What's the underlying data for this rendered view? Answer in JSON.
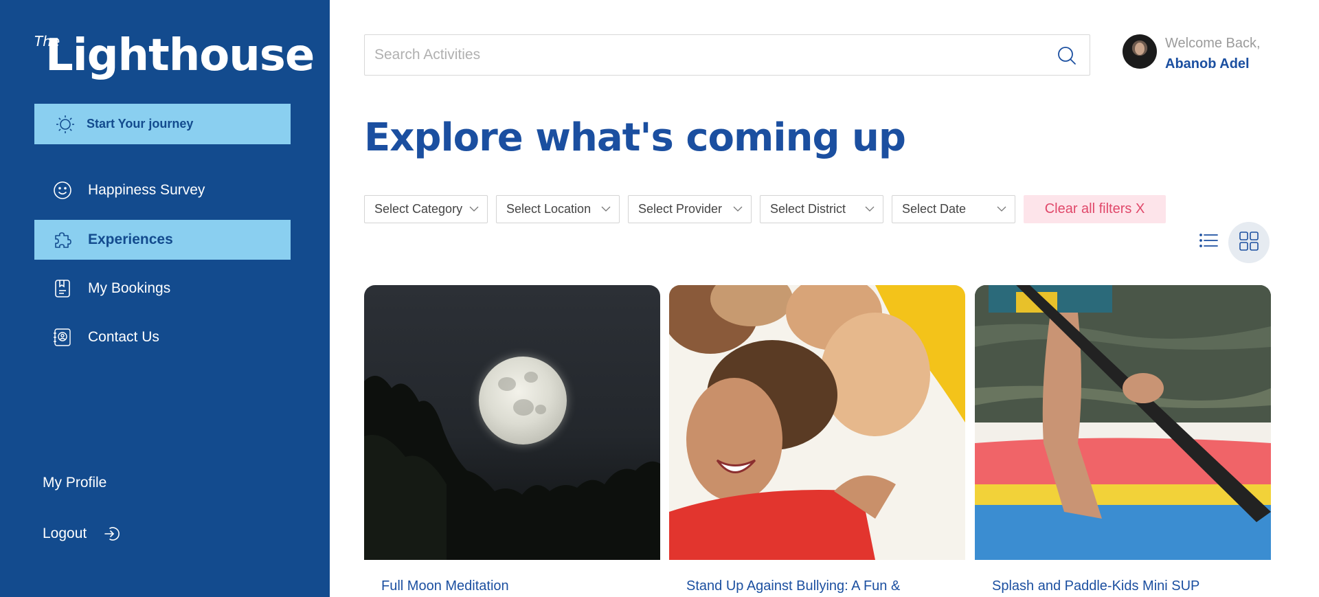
{
  "brand": {
    "logo_the": "The",
    "logo_word": "Lighthouse"
  },
  "sidebar": {
    "journey_label": "Start Your journey",
    "items": [
      {
        "label": "Happiness Survey",
        "icon": "smile-icon",
        "active": false
      },
      {
        "label": "Experiences",
        "icon": "puzzle-icon",
        "active": true
      },
      {
        "label": "My Bookings",
        "icon": "bookings-icon",
        "active": false
      },
      {
        "label": "Contact Us",
        "icon": "contact-icon",
        "active": false
      }
    ],
    "profile_label": "My Profile",
    "logout_label": "Logout"
  },
  "search": {
    "placeholder": "Search Activities"
  },
  "user": {
    "welcome": "Welcome Back,",
    "name": "Abanob Adel"
  },
  "main": {
    "title": "Explore what's coming up",
    "filters": [
      "Select Category",
      "Select Location",
      "Select Provider",
      "Select District",
      "Select Date"
    ],
    "clear_label": "Clear all filters X",
    "view_mode": "grid"
  },
  "cards": [
    {
      "title": "Full Moon Meditation"
    },
    {
      "title": "Stand Up Against Bullying: A Fun &"
    },
    {
      "title": "Splash and Paddle-Kids Mini SUP"
    }
  ],
  "colors": {
    "sidebar_bg": "#134b8e",
    "active_bg": "#8acff0",
    "accent": "#1b4fa0",
    "clear_bg": "#fde4ea",
    "clear_text": "#e0486a"
  }
}
